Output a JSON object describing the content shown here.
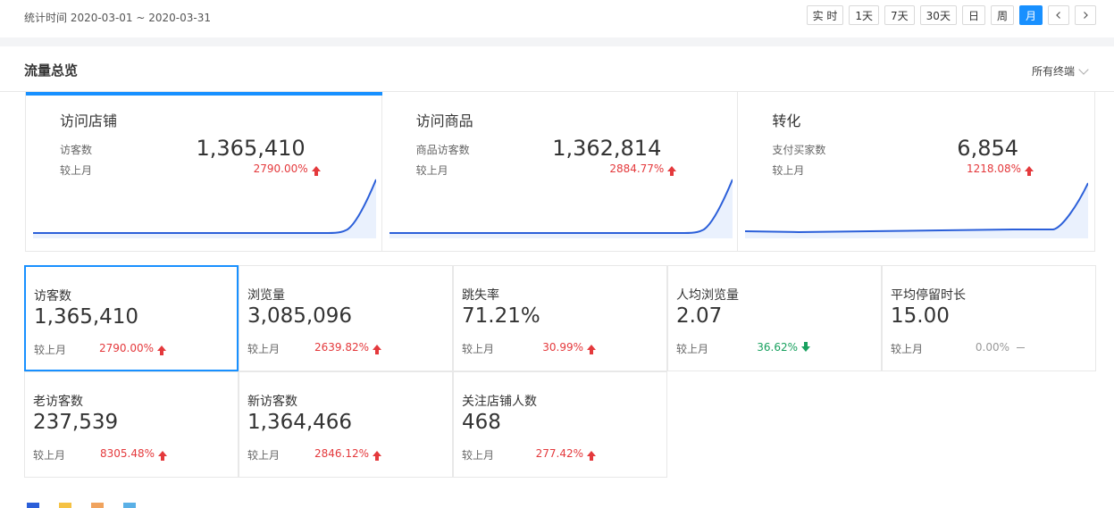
{
  "header": {
    "period": "统计时间 2020-03-01 ~ 2020-03-31",
    "range_buttons": [
      "实 时",
      "1天",
      "7天",
      "30天",
      "日",
      "周",
      "月"
    ],
    "active_range": "月"
  },
  "section": {
    "title": "流量总览",
    "terminal": "所有终端"
  },
  "overview": [
    {
      "title": "访问店铺",
      "metric": "访客数",
      "value": "1,365,410",
      "compare": "较上月",
      "change": "2790.00%",
      "trend": "up",
      "active": true
    },
    {
      "title": "访问商品",
      "metric": "商品访客数",
      "value": "1,362,814",
      "compare": "较上月",
      "change": "2884.77%",
      "trend": "up",
      "active": false
    },
    {
      "title": "转化",
      "metric": "支付买家数",
      "value": "6,854",
      "compare": "较上月",
      "change": "1218.08%",
      "trend": "up",
      "active": false
    }
  ],
  "metrics": [
    {
      "label": "访客数",
      "value": "1,365,410",
      "compare": "较上月",
      "change": "2790.00%",
      "trend": "up",
      "active": true
    },
    {
      "label": "浏览量",
      "value": "3,085,096",
      "compare": "较上月",
      "change": "2639.82%",
      "trend": "up"
    },
    {
      "label": "跳失率",
      "value": "71.21%",
      "compare": "较上月",
      "change": "30.99%",
      "trend": "up"
    },
    {
      "label": "人均浏览量",
      "value": "2.07",
      "compare": "较上月",
      "change": "36.62%",
      "trend": "down"
    },
    {
      "label": "平均停留时长",
      "value": "15.00",
      "compare": "较上月",
      "change": "0.00%",
      "trend": "flat"
    },
    {
      "label": "老访客数",
      "value": "237,539",
      "compare": "较上月",
      "change": "8305.48%",
      "trend": "up"
    },
    {
      "label": "新访客数",
      "value": "1,364,466",
      "compare": "较上月",
      "change": "2846.12%",
      "trend": "up"
    },
    {
      "label": "关注店铺人数",
      "value": "468",
      "compare": "较上月",
      "change": "277.42%",
      "trend": "up"
    }
  ],
  "colors": {
    "accent": "#1890ff",
    "up": "#e4393c",
    "down": "#19a15f",
    "line": "#2b5fd9"
  },
  "icons": [
    "chevron-down-icon",
    "chevron-left-icon",
    "chevron-right-icon",
    "arrow-up-icon",
    "arrow-down-icon"
  ]
}
